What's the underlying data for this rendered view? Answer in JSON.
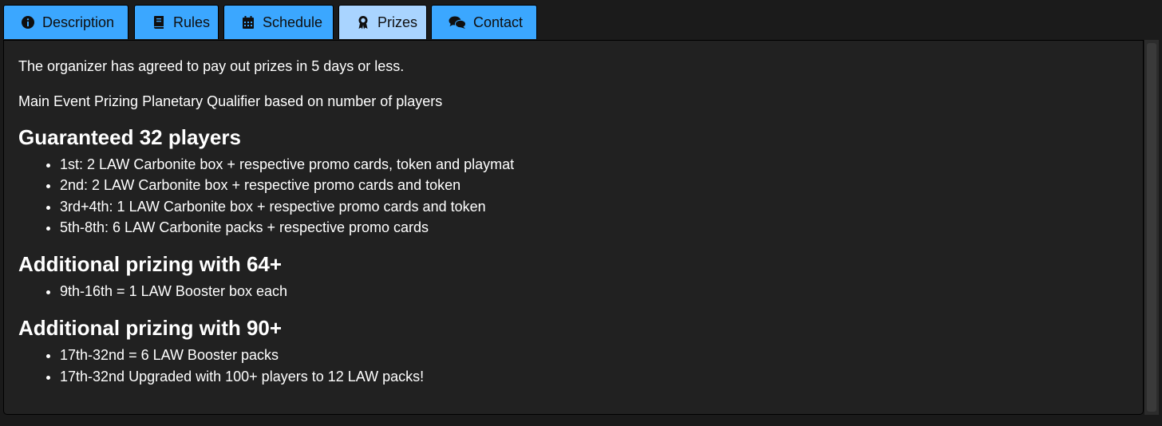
{
  "tabs": [
    {
      "label": "Description",
      "icon": "info-circle-icon",
      "active": false
    },
    {
      "label": "Rules",
      "icon": "book-icon",
      "active": false
    },
    {
      "label": "Schedule",
      "icon": "calendar-icon",
      "active": false
    },
    {
      "label": "Prizes",
      "icon": "award-icon",
      "active": true
    },
    {
      "label": "Contact",
      "icon": "chat-bubbles-icon",
      "active": false
    }
  ],
  "colors": {
    "tab_background": "#3ba7ff",
    "tab_active_background": "#a9d4ff",
    "panel_background": "#212121",
    "page_background": "#1a1a1a",
    "text": "#ffffff"
  },
  "content": {
    "intro": "The organizer has agreed to pay out prizes in 5 days or less.",
    "subtitle": "Main Event Prizing Planetary Qualifier based on number of players",
    "sections": [
      {
        "heading": "Guaranteed 32 players",
        "items": [
          "1st: 2 LAW Carbonite box + respective promo cards, token and playmat",
          "2nd: 2 LAW Carbonite box + respective promo cards and token",
          "3rd+4th: 1 LAW Carbonite box + respective promo cards and token",
          "5th-8th: 6 LAW Carbonite packs + respective promo cards"
        ]
      },
      {
        "heading": "Additional prizing with 64+",
        "items": [
          "9th-16th = 1 LAW Booster box each"
        ]
      },
      {
        "heading": "Additional prizing with 90+",
        "items": [
          "17th-32nd = 6 LAW Booster packs",
          "17th-32nd Upgraded with 100+ players to 12 LAW packs!"
        ]
      }
    ]
  }
}
